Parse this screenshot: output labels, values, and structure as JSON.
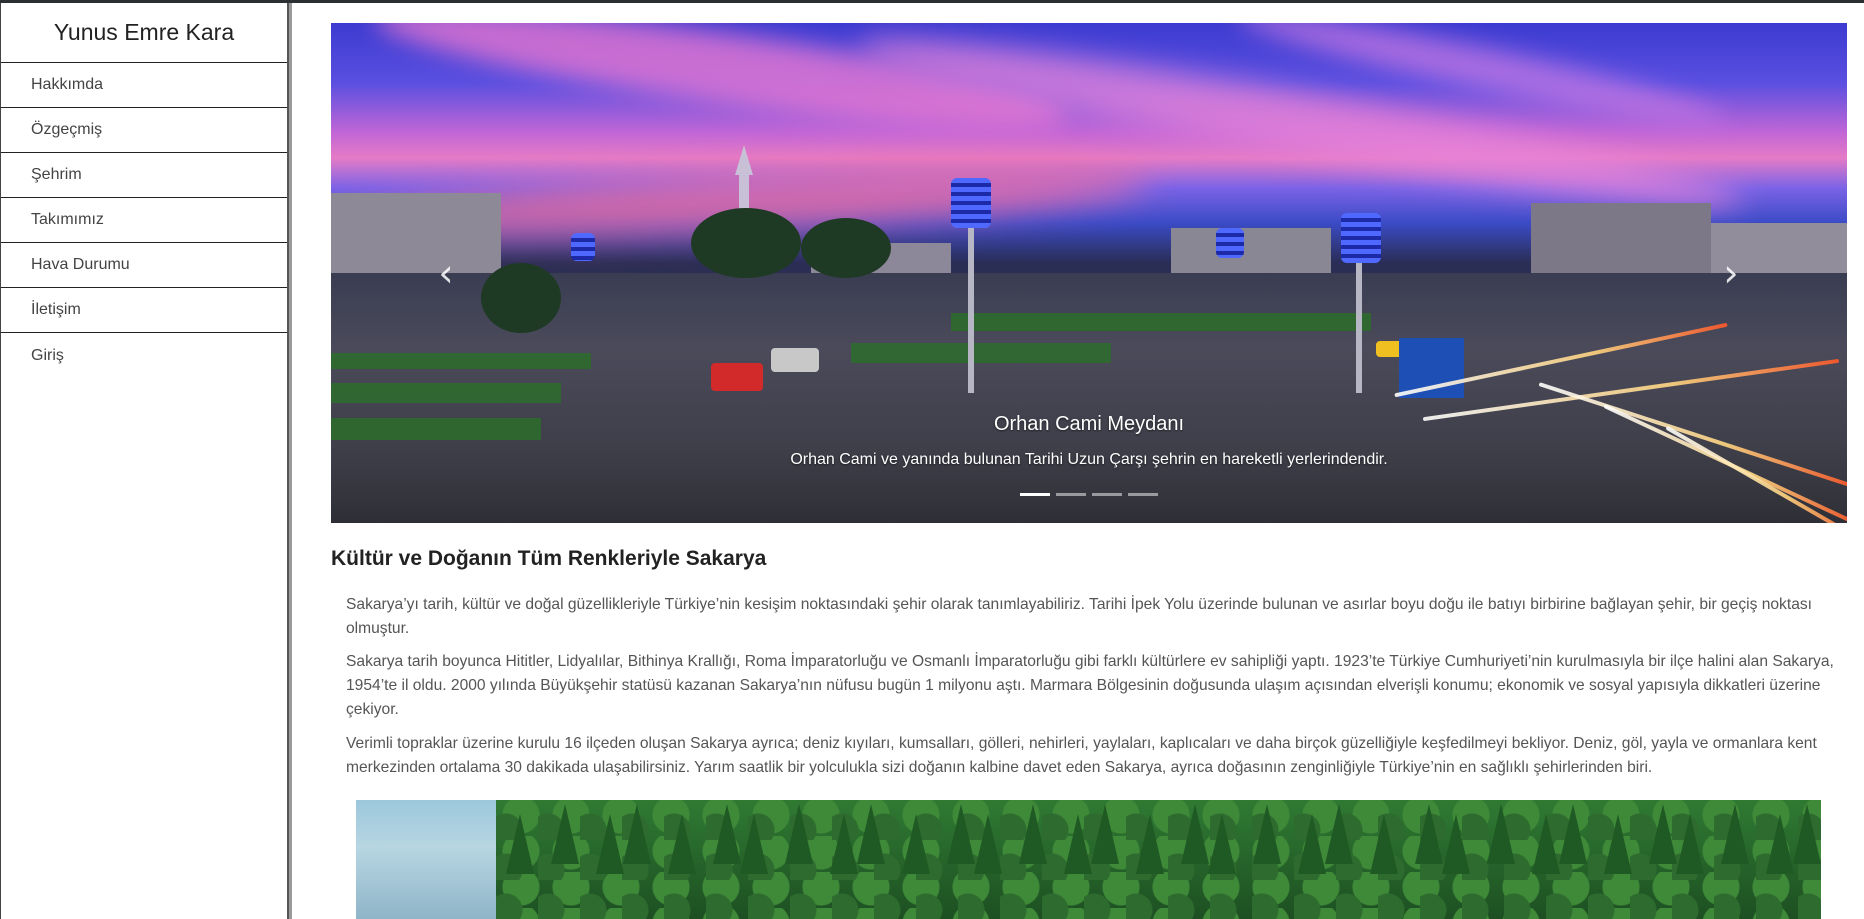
{
  "sidebar": {
    "brand": "Yunus Emre Kara",
    "items": [
      {
        "label": "Hakkımda"
      },
      {
        "label": "Özgeçmiş"
      },
      {
        "label": "Şehrim"
      },
      {
        "label": "Takımımız"
      },
      {
        "label": "Hava Durumu"
      },
      {
        "label": "İletişim"
      },
      {
        "label": "Giriş"
      }
    ]
  },
  "carousel": {
    "caption_title": "Orhan Cami Meydanı",
    "caption_text": "Orhan Cami ve yanında bulunan Tarihi Uzun Çarşı şehrin en hareketli yerlerindendir.",
    "prev_icon": "‹",
    "next_icon": "›",
    "slide_count": 4,
    "active_index": 0
  },
  "main": {
    "heading": "Kültür ve Doğanın Tüm Renkleriyle Sakarya",
    "paragraphs": [
      "Sakarya’yı tarih, kültür ve doğal güzellikleriyle Türkiye’nin kesişim noktasındaki şehir olarak tanımlayabiliriz. Tarihi İpek Yolu üzerinde bulunan ve asırlar boyu doğu ile batıyı birbirine bağlayan şehir, bir geçiş noktası olmuştur.",
      "Sakarya tarih boyunca Hititler, Lidyalılar, Bithinya Krallığı, Roma İmparatorluğu ve Osmanlı İmparatorluğu gibi farklı kültürlere ev sahipliği yaptı. 1923’te Türkiye Cumhuriyeti’nin kurulmasıyla bir ilçe halini alan Sakarya, 1954’te il oldu. 2000 yılında Büyükşehir statüsü kazanan Sakarya’nın nüfusu bugün 1 milyonu aştı. Marmara Bölgesinin doğusunda ulaşım açısından elverişli konumu; ekonomik ve sosyal yapısıyla dikkatleri üzerine çekiyor.",
      "Verimli topraklar üzerine kurulu 16 ilçeden oluşan Sakarya ayrıca; deniz kıyıları, kumsalları, gölleri, nehirleri, yaylaları, kaplıcaları ve daha birçok güzelliğiyle keşfedilmeyi bekliyor. Deniz, göl, yayla ve ormanlara kent merkezinden ortalama 30 dakikada ulaşabilirsiniz. Yarım saatlik bir yolculukla sizi doğanın kalbine davet eden Sakarya, ayrıca doğasının zenginliğiyle Türkiye’nin en sağlıklı şehirlerinden biri."
    ]
  },
  "colors": {
    "text": "#555555",
    "heading": "#222222",
    "border": "#222222"
  }
}
